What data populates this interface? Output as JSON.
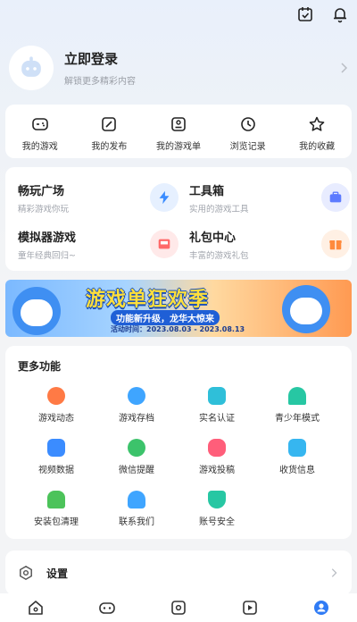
{
  "topbar": {
    "icons": [
      "calendar-check-icon",
      "bell-icon"
    ]
  },
  "login": {
    "title": "立即登录",
    "subtitle": "解锁更多精彩内容"
  },
  "quick": [
    {
      "label": "我的游戏",
      "icon": "gamepad-icon"
    },
    {
      "label": "我的发布",
      "icon": "edit-icon"
    },
    {
      "label": "我的游戏单",
      "icon": "list-icon"
    },
    {
      "label": "浏览记录",
      "icon": "clock-icon"
    },
    {
      "label": "我的收藏",
      "icon": "star-icon"
    }
  ],
  "features": [
    {
      "title": "畅玩广场",
      "subtitle": "精彩游戏你玩",
      "icon": "lightning-icon",
      "color": "#3a8cff",
      "bg": "#e6f0ff"
    },
    {
      "title": "工具箱",
      "subtitle": "实用的游戏工具",
      "icon": "toolbox-icon",
      "color": "#5d7bff",
      "bg": "#e8ecff"
    },
    {
      "title": "模拟器游戏",
      "subtitle": "童年经典回归~",
      "icon": "emulator-icon",
      "color": "#ff6a6a",
      "bg": "#ffe9e9"
    },
    {
      "title": "礼包中心",
      "subtitle": "丰富的游戏礼包",
      "icon": "gift-icon",
      "color": "#ff8a3c",
      "bg": "#fff0e4"
    }
  ],
  "banner": {
    "title": "游戏单狂欢季",
    "subtitle": "功能新升级，龙华大惊来",
    "date": "活动时间：2023.08.03 - 2023.08.13"
  },
  "more": {
    "title": "更多功能",
    "items": [
      {
        "label": "游戏动态",
        "icon": "dynamic-icon",
        "color": "#ff7a45"
      },
      {
        "label": "游戏存档",
        "icon": "cloud-upload-icon",
        "color": "#3fa5ff"
      },
      {
        "label": "实名认证",
        "icon": "id-card-icon",
        "color": "#2fbfd9"
      },
      {
        "label": "青少年模式",
        "icon": "umbrella-icon",
        "color": "#27c7a3"
      },
      {
        "label": "视频数据",
        "icon": "chart-icon",
        "color": "#3b8cff"
      },
      {
        "label": "微信提醒",
        "icon": "wechat-icon",
        "color": "#3cc36b"
      },
      {
        "label": "游戏投稿",
        "icon": "controller-icon",
        "color": "#ff5e7a"
      },
      {
        "label": "收货信息",
        "icon": "package-icon",
        "color": "#36b6f0"
      },
      {
        "label": "安装包清理",
        "icon": "android-icon",
        "color": "#4cc35a"
      },
      {
        "label": "联系我们",
        "icon": "headset-icon",
        "color": "#3fa5ff"
      },
      {
        "label": "账号安全",
        "icon": "shield-icon",
        "color": "#27c7a3"
      }
    ]
  },
  "settings": {
    "label": "设置"
  },
  "tabbar": {
    "tabs": [
      "home-icon",
      "game-icon",
      "community-icon",
      "video-icon",
      "profile-icon"
    ]
  }
}
